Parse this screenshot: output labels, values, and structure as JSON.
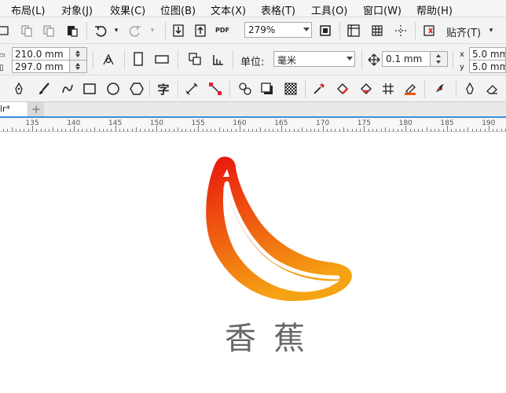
{
  "menubar": {
    "items": [
      "布局(L)",
      "对象(J)",
      "效果(C)",
      "位图(B)",
      "文本(X)",
      "表格(T)",
      "工具(O)",
      "窗口(W)",
      "帮助(H)"
    ]
  },
  "toolbar": {
    "zoom_value": "279%",
    "snap_label": "贴齐(T)",
    "offset_x": "5.0 mm",
    "offset_y": "5.0 mm",
    "pdf_label": "PDF"
  },
  "propbar": {
    "width_value": "210.0 mm",
    "height_value": "297.0 mm",
    "units_label": "单位:",
    "units_value": "毫米",
    "nudge_value": "0.1 mm",
    "dup_x": "5.0 mm",
    "dup_y": "5.0 mm"
  },
  "toolbox": {
    "text_tool_glyph": "字"
  },
  "tabbar": {
    "doc_tab": "lr*",
    "add_tab": "+"
  },
  "ruler": {
    "labels": [
      "135",
      "140",
      "145",
      "150",
      "155",
      "160",
      "165",
      "170",
      "175",
      "180",
      "185",
      "190"
    ]
  },
  "artwork": {
    "caption": "香蕉",
    "gradient_top": "#e8140f",
    "gradient_bottom": "#f6a313"
  }
}
